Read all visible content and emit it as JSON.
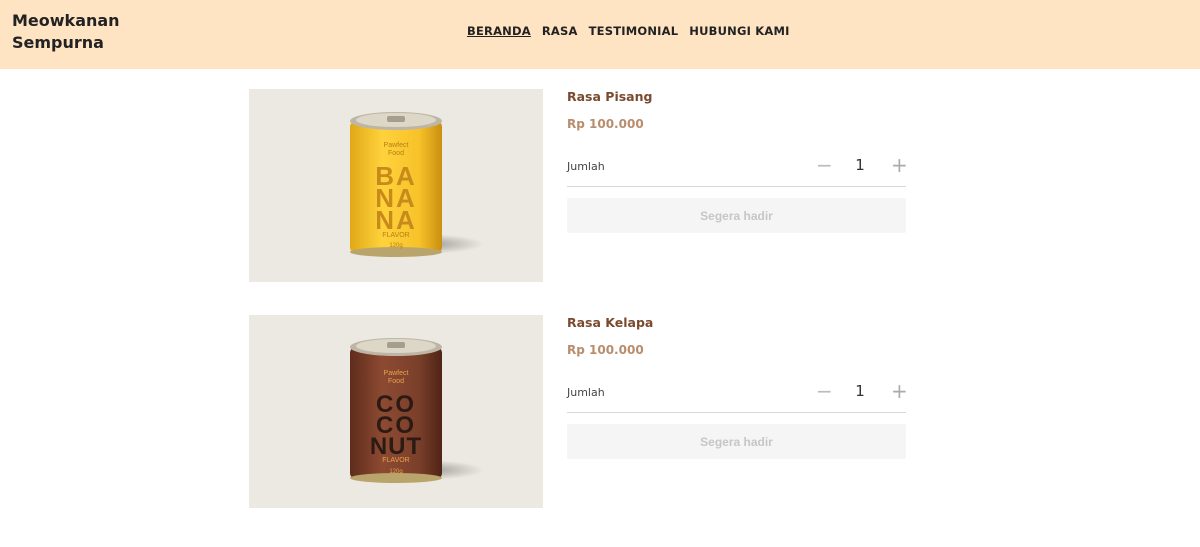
{
  "header": {
    "brand_line1": "Meowkanan",
    "brand_line2": "Sempurna",
    "nav": [
      "BERANDA",
      "RASA",
      "TESTIMONIAL",
      "HUBUNGI KAMI"
    ]
  },
  "products": [
    {
      "name": "Rasa Pisang",
      "price": "Rp 100.000",
      "qty_label": "Jumlah",
      "qty": "1",
      "button": "Segera hadir",
      "can": {
        "brand": "Pawfect Food",
        "lines": [
          "BA",
          "NA",
          "NA"
        ],
        "flavor": "FLAVOR",
        "weight": "120g",
        "color": "#f5c02a",
        "text_color": "#c88b1b"
      }
    },
    {
      "name": "Rasa Kelapa",
      "price": "Rp 100.000",
      "qty_label": "Jumlah",
      "qty": "1",
      "button": "Segera hadir",
      "can": {
        "brand": "Pawfect Food",
        "lines": [
          "CO",
          "CO",
          "NUT"
        ],
        "flavor": "FLAVOR",
        "weight": "120g",
        "color": "#7a3f2a",
        "text_color": "#2c1a14"
      }
    }
  ],
  "icons": {
    "minus": "−",
    "plus": "+"
  }
}
